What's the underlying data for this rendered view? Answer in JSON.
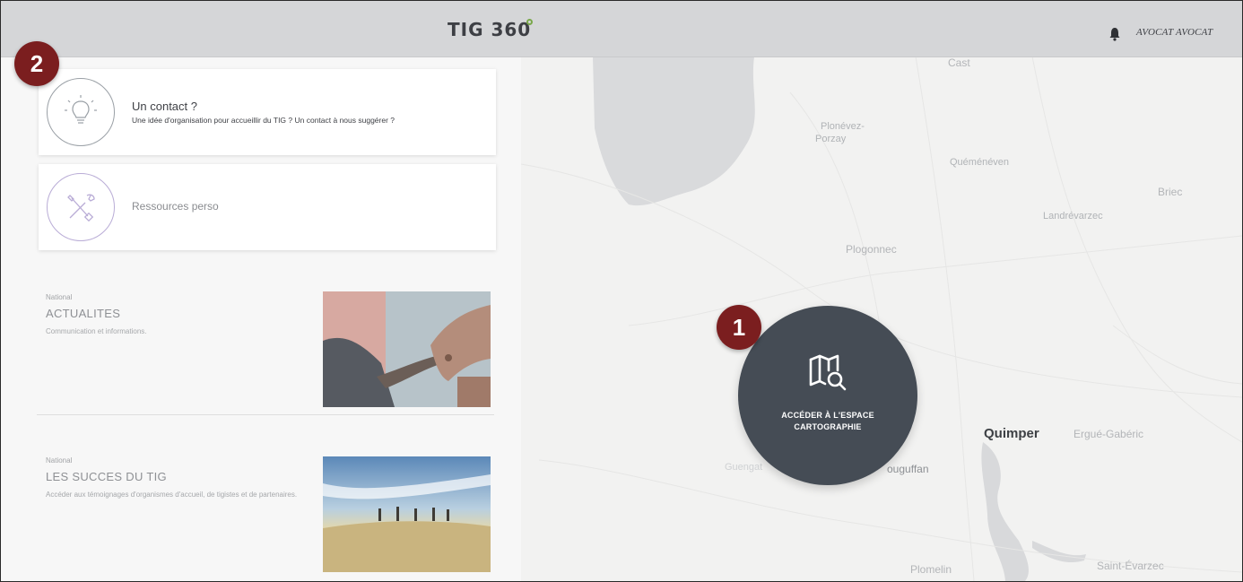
{
  "header": {
    "brand": "TIG 360",
    "user_label": "AVOCAT AVOCAT"
  },
  "badges": {
    "one": "1",
    "two": "2"
  },
  "cards": [
    {
      "title": "Un contact ?",
      "subtitle": "Une idée d'organisation pour accueillir du TIG ? Un contact à nous suggérer ?",
      "icon": "lightbulb-icon"
    },
    {
      "title": "Ressources perso",
      "icon": "tools-icon"
    }
  ],
  "news": [
    {
      "category": "National",
      "title": "ACTUALITES",
      "description": "Communication et informations."
    },
    {
      "category": "National",
      "title": "LES SUCCES DU TIG",
      "description": "Accéder aux témoignages d'organismes d'accueil, de tigistes et de partenaires."
    }
  ],
  "cta": {
    "label_line1": "ACCÉDER À L'ESPACE",
    "label_line2": "CARTOGRAPHIE",
    "icon": "map-search-icon"
  },
  "map_places": [
    "Cast",
    "Plonévez-",
    "Porzay",
    "Quéménéven",
    "Briec",
    "Landrévarzec",
    "Plogonnec",
    "Quimper",
    "Ergué-Gabéric",
    "Guengat",
    "ouguffan",
    "Plomelin",
    "Saint-Évarzec"
  ],
  "colors": {
    "topbar": "#d5d6d8",
    "cta": "#454c55",
    "badge": "#7b1e1f",
    "accent_green": "#7aa84b"
  }
}
